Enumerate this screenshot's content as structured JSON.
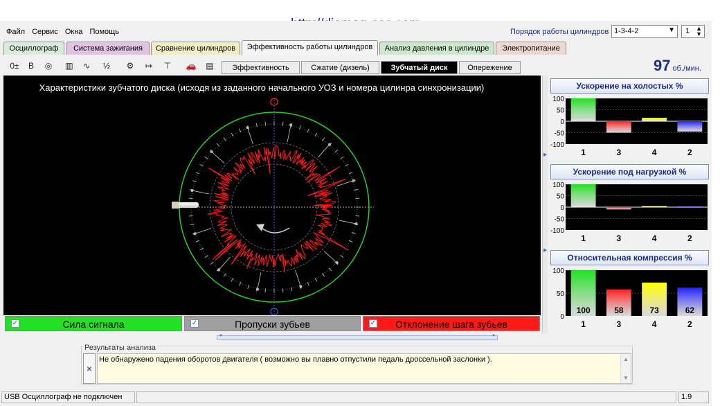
{
  "url": "http://diamag-osc.com",
  "menu": [
    "Файл",
    "Сервис",
    "Окна",
    "Помощь"
  ],
  "firing_order": {
    "label": "Порядок работы цилиндров",
    "value": "1-3-4-2",
    "cylinder_value": "1"
  },
  "tabs": [
    {
      "label": "Осциллограф",
      "color": "#d9ecd9"
    },
    {
      "label": "Система зажигания",
      "color": "#e3c3e3"
    },
    {
      "label": "Сравнение цилиндров",
      "color": "#efefc3"
    },
    {
      "label": "Эффективность работы цилиндров",
      "color": "#f4f4f4"
    },
    {
      "label": "Анализ давления в цилиндре",
      "color": "#cde8cd"
    },
    {
      "label": "Электропитание",
      "color": "#eed8d0"
    }
  ],
  "toolbar_icons": [
    "zero-shift-icon",
    "bold-icon",
    "rpm-icon",
    "table-icon",
    "signal-icon",
    "algorithm-icon",
    "cylinder-map-icon",
    "numbering-icon",
    "filter-icon",
    "car-icon",
    "measure-icon"
  ],
  "toolbar_icon_glyphs": [
    "0±",
    "B",
    "◎",
    "▥",
    "∿",
    "½",
    "⚙",
    "↦",
    "⊤",
    "🚗",
    "▤"
  ],
  "subtabs": [
    "Эффективность",
    "Сжатие (дизель)",
    "Зубчатый диск",
    "Опережение"
  ],
  "active_subtab": "Зубчатый диск",
  "rpm": {
    "value": "97",
    "unit": "об./мин."
  },
  "plot": {
    "title": "Характеристики зубчатого диска (исходя из заданного начального УОЗ и номера цилинра синхронизации)"
  },
  "checkboxes": [
    {
      "label": "Сила сигнала",
      "color": "#22e022",
      "checked": true
    },
    {
      "label": "Пропуски зубьев",
      "color": "#a0a0a0",
      "checked": true
    },
    {
      "label": "Отклонение шага зубьев",
      "color": "#ff1a1a",
      "checked": true
    }
  ],
  "results": {
    "title": "Результаты анализа",
    "text": "Не обнаружено падения оборотов двигателя ( возможно вы плавно отпустили педаль дроссельной заслонки ).",
    "close_glyph": "×"
  },
  "status": {
    "left": "USB Осциллограф не подключен",
    "right": "1.9"
  },
  "chart_data": [
    {
      "type": "bar",
      "title": "Ускорение на холостых %",
      "categories": [
        "1",
        "3",
        "4",
        "2"
      ],
      "values": [
        100,
        -50,
        15,
        -45
      ],
      "colors": [
        "#22e022",
        "#ff2020",
        "#ffff00",
        "#2020ff"
      ],
      "ylim": [
        -100,
        100
      ],
      "yticks": [
        "100",
        "50",
        "0",
        "-50",
        "-100"
      ],
      "data_labels": [
        "",
        "-50",
        "",
        ""
      ]
    },
    {
      "type": "bar",
      "title": "Ускорение под нагрузкой %",
      "categories": [
        "1",
        "3",
        "4",
        "2"
      ],
      "values": [
        100,
        -10,
        5,
        3
      ],
      "colors": [
        "#22e022",
        "#ff2020",
        "#ffff00",
        "#2020ff"
      ],
      "ylim": [
        -100,
        100
      ],
      "yticks": [
        "100",
        "50",
        "0",
        "-50",
        "-100"
      ],
      "data_labels": [
        "",
        "",
        "",
        ""
      ]
    },
    {
      "type": "bar",
      "title": "Относительная компрессия %",
      "categories": [
        "1",
        "3",
        "4",
        "2"
      ],
      "values": [
        100,
        58,
        73,
        62
      ],
      "colors": [
        "#22e022",
        "#ff2020",
        "#ffff00",
        "#2020ff"
      ],
      "ylim": [
        0,
        100
      ],
      "yticks": [
        "100",
        "50",
        "0"
      ],
      "data_labels": [
        "100",
        "58",
        "73",
        "62"
      ]
    }
  ]
}
